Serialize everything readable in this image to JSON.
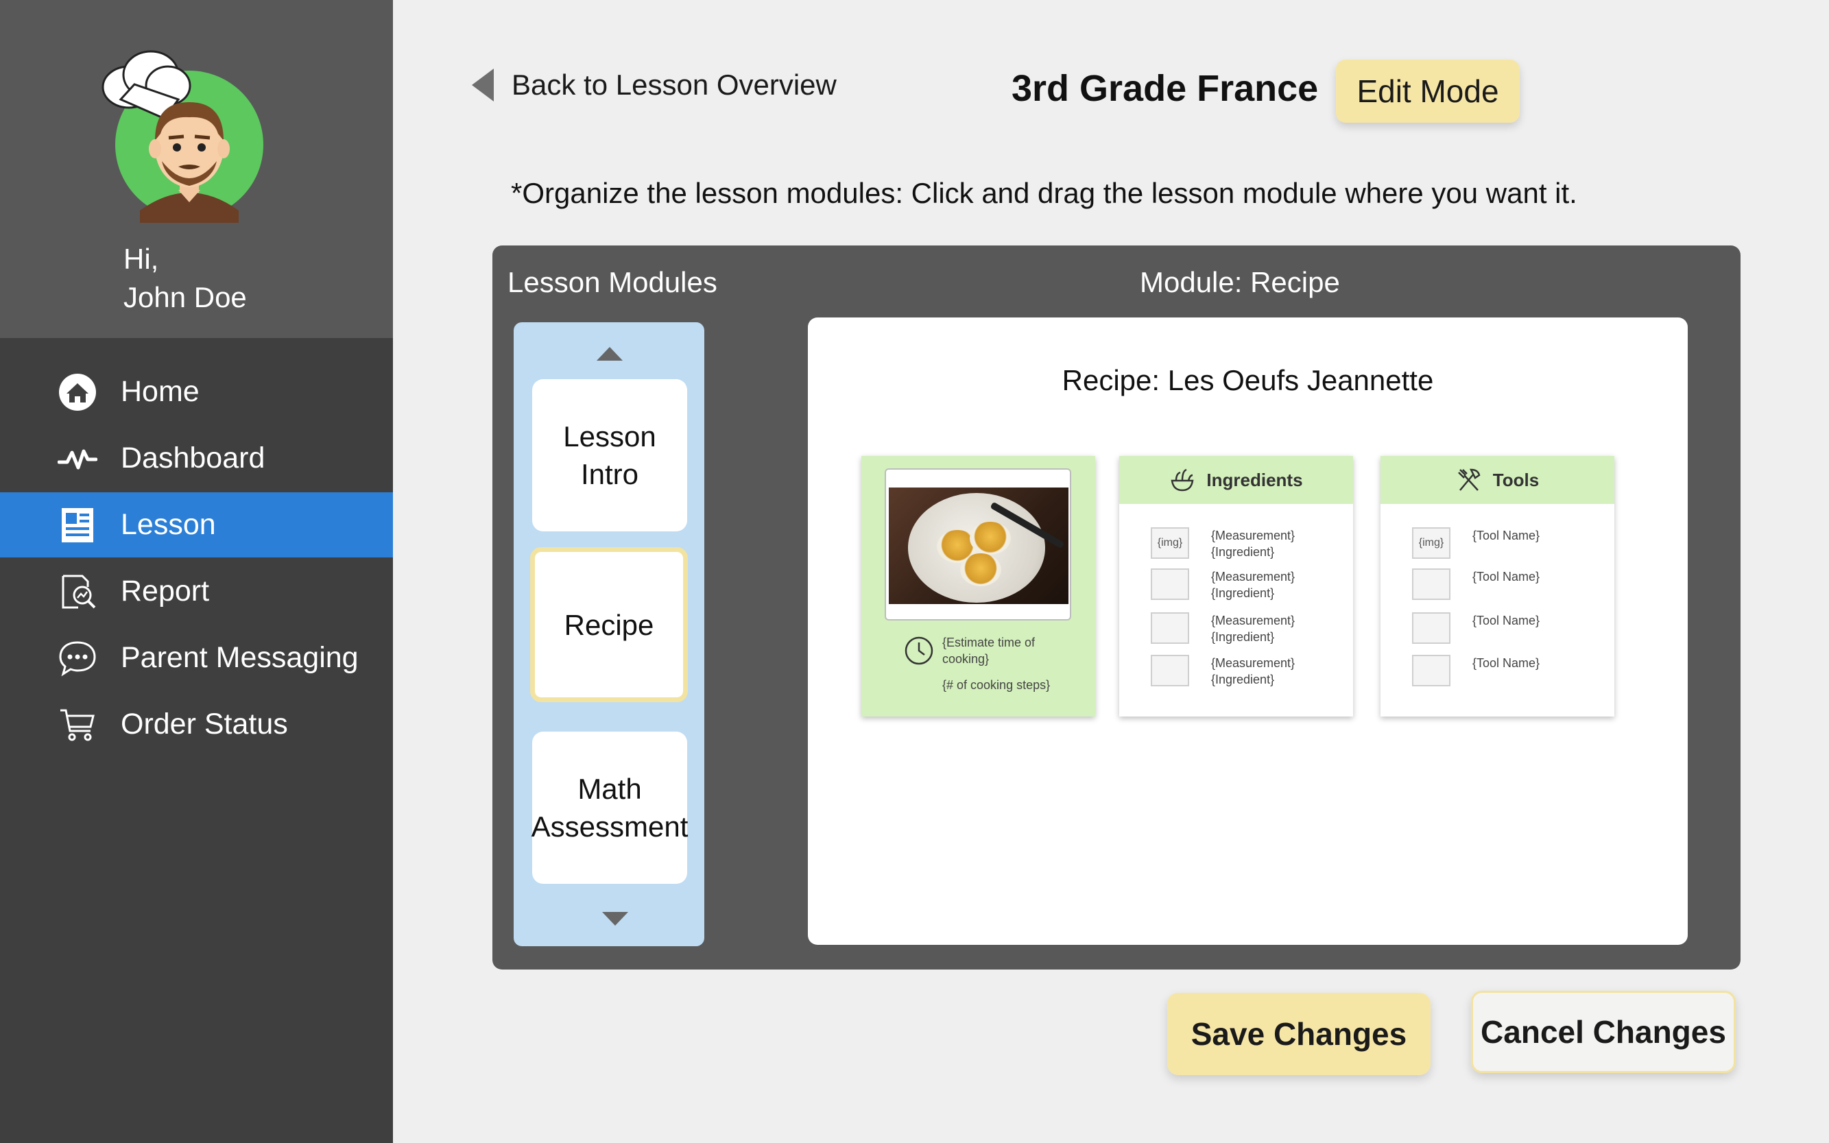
{
  "sidebar": {
    "greeting_line1": "Hi,",
    "greeting_line2": "John Doe",
    "items": [
      {
        "label": "Home",
        "icon": "home-icon",
        "active": false
      },
      {
        "label": "Dashboard",
        "icon": "pulse-icon",
        "active": false
      },
      {
        "label": "Lesson",
        "icon": "document-icon",
        "active": true
      },
      {
        "label": "Report",
        "icon": "report-search-icon",
        "active": false
      },
      {
        "label": "Parent Messaging",
        "icon": "chat-bubble-icon",
        "active": false
      },
      {
        "label": "Order Status",
        "icon": "cart-icon",
        "active": false
      }
    ]
  },
  "header": {
    "back_label": "Back to Lesson Overview",
    "title": "3rd Grade France",
    "mode_badge": "Edit Mode",
    "instruction": "*Organize the lesson modules: Click and drag the lesson module where you want it."
  },
  "panel": {
    "modules_heading": "Lesson Modules",
    "module_heading": "Module: Recipe",
    "modules": [
      {
        "line1": "Lesson",
        "line2": "Intro"
      },
      {
        "line1": "Recipe",
        "line2": ""
      },
      {
        "line1": "Math",
        "line2": "Assessment"
      }
    ],
    "selected_module": "Recipe"
  },
  "recipe": {
    "title": "Recipe: Les Oeufs Jeannette",
    "photo_card": {
      "time_line1": "{Estimate time of",
      "time_line2": "cooking}",
      "steps": "{# of cooking steps}"
    },
    "ingredients": {
      "heading": "Ingredients",
      "img_placeholder": "{img}",
      "rows": [
        {
          "line1": "{Measurement}",
          "line2": "{Ingredient}"
        },
        {
          "line1": "{Measurement}",
          "line2": "{Ingredient}"
        },
        {
          "line1": "{Measurement}",
          "line2": "{Ingredient}"
        },
        {
          "line1": "{Measurement}",
          "line2": "{Ingredient}"
        }
      ]
    },
    "tools": {
      "heading": "Tools",
      "img_placeholder": "{img}",
      "rows": [
        "{Tool Name}",
        "{Tool Name}",
        "{Tool Name}",
        "{Tool Name}"
      ]
    }
  },
  "actions": {
    "save": "Save Changes",
    "cancel": "Cancel Changes"
  },
  "colors": {
    "sidebar_bg": "#3f3f3f",
    "profile_bg": "#585858",
    "active_nav": "#2c7fd6",
    "highlight_yellow": "#f6e6a6",
    "module_list_bg": "#bfdcf3",
    "card_green": "#d4f0bd"
  }
}
